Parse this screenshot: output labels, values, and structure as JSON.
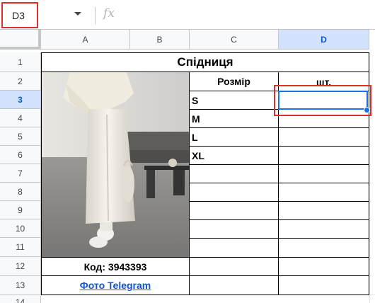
{
  "formula_bar": {
    "name_box": "D3",
    "fx_label": "fx",
    "value": ""
  },
  "columns": [
    "A",
    "B",
    "C",
    "D"
  ],
  "rows": [
    "1",
    "2",
    "3",
    "4",
    "5",
    "6",
    "7",
    "8",
    "9",
    "10",
    "11",
    "12",
    "13",
    "14"
  ],
  "selected_cell": "D3",
  "sheet": {
    "title": "Спідниця",
    "size_header": "Розмір",
    "qty_header": "шт.",
    "sizes": [
      "S",
      "M",
      "L",
      "XL"
    ],
    "code": "Код: 3943393",
    "photo_link": "Фото Telegram"
  },
  "colors": {
    "accent": "#1a73e8",
    "highlight_red": "#d9312b",
    "header_bg": "#f8f9fa",
    "selected_header_bg": "#d3e3fd",
    "link": "#1155cc"
  }
}
